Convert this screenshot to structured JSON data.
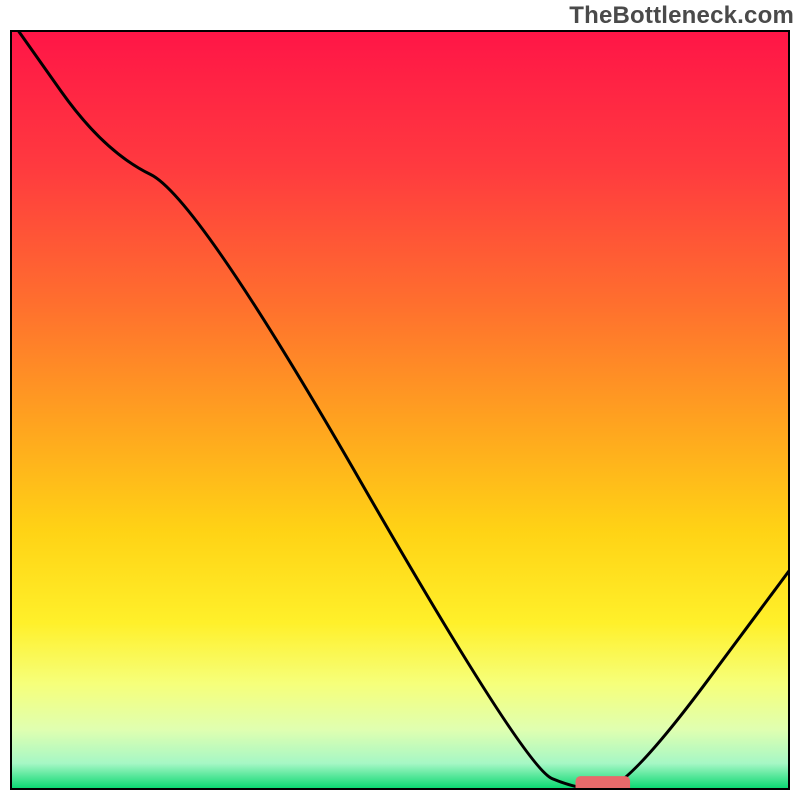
{
  "watermark": "TheBottleneck.com",
  "chart_data": {
    "type": "line",
    "title": "",
    "xlabel": "",
    "ylabel": "",
    "xlim": [
      0,
      100
    ],
    "ylim": [
      0,
      100
    ],
    "grid": false,
    "series": [
      {
        "name": "curve",
        "x": [
          1,
          12,
          24,
          66,
          73,
          79,
          100
        ],
        "y": [
          100,
          84,
          78,
          3,
          0,
          0,
          29
        ],
        "color": "#000000"
      }
    ],
    "marker": {
      "x_range": [
        72.5,
        79.5
      ],
      "y": 0.4,
      "color": "#e76a6a",
      "thickness": 1.8
    },
    "gradient_stops": [
      {
        "offset": 0.0,
        "color": "#ff1547"
      },
      {
        "offset": 0.18,
        "color": "#ff3a3f"
      },
      {
        "offset": 0.36,
        "color": "#ff6f2e"
      },
      {
        "offset": 0.52,
        "color": "#ffa41f"
      },
      {
        "offset": 0.66,
        "color": "#ffd315"
      },
      {
        "offset": 0.78,
        "color": "#fff02a"
      },
      {
        "offset": 0.86,
        "color": "#f6ff7a"
      },
      {
        "offset": 0.92,
        "color": "#e0ffb0"
      },
      {
        "offset": 0.965,
        "color": "#a6f7c5"
      },
      {
        "offset": 1.0,
        "color": "#00d66c"
      }
    ],
    "frame_color": "#000000"
  }
}
